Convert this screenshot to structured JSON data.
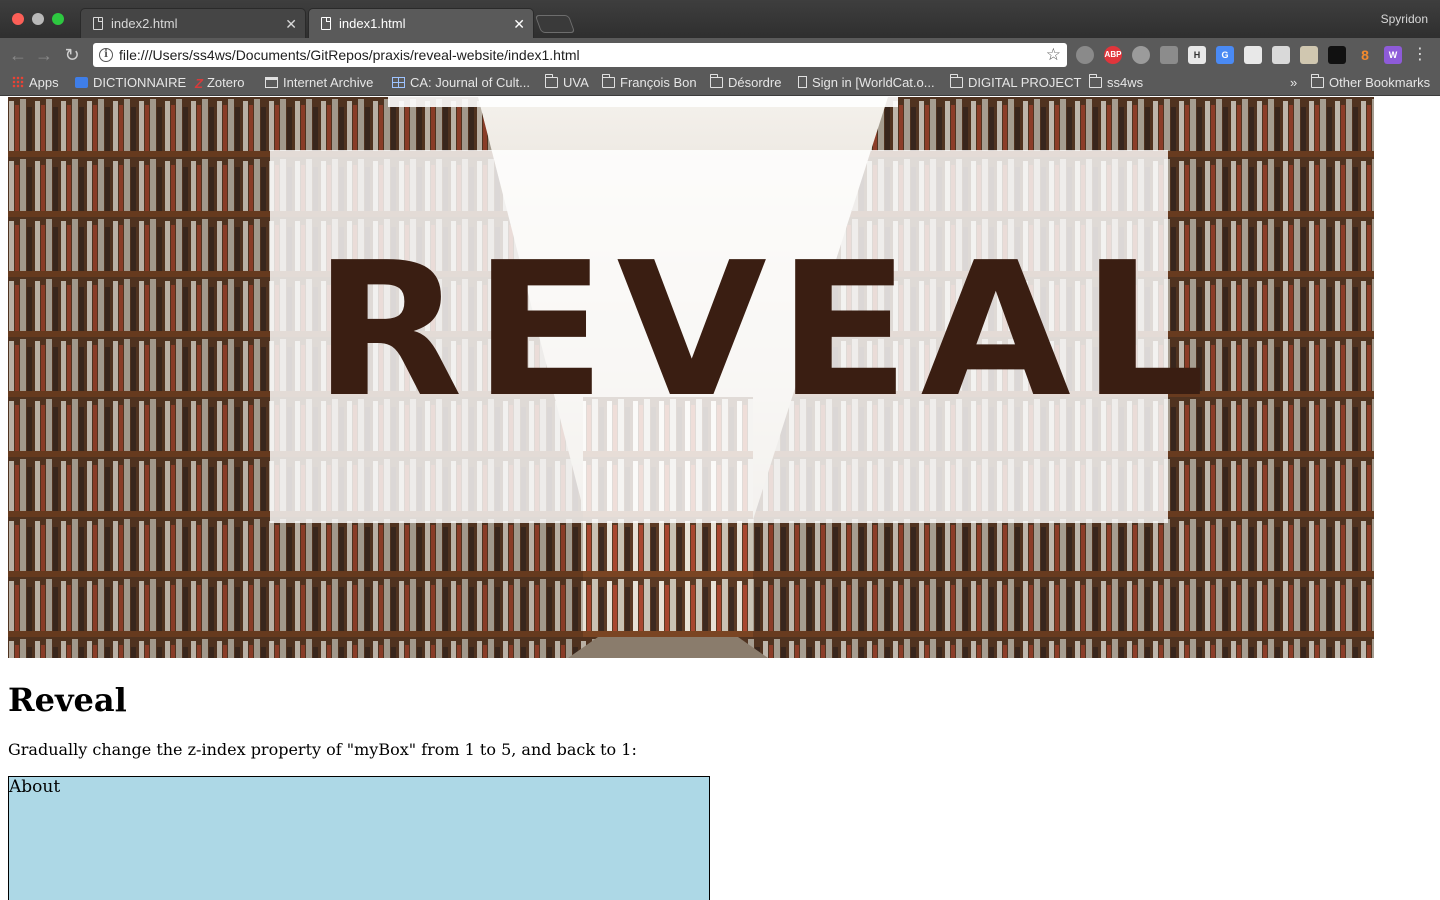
{
  "window": {
    "profile_name": "Spyridon"
  },
  "tabs": [
    {
      "title": "index2.html",
      "active": false
    },
    {
      "title": "index1.html",
      "active": true
    }
  ],
  "toolbar": {
    "url": "file:///Users/ss4ws/Documents/GitRepos/praxis/reveal-website/index1.html",
    "extensions": [
      "pocket-icon",
      "adblock-plus-icon",
      "extension-icon",
      "chat-icon",
      "hypothesis-icon",
      "translate-icon",
      "mail-icon",
      "document-icon",
      "cookie-icon",
      "lock-icon",
      "fire-icon",
      "wix-icon"
    ],
    "adblock_label": "ABP"
  },
  "bookmarks": {
    "items": [
      {
        "label": "Apps",
        "icon": "apps-icon"
      },
      {
        "label": "DICTIONNAIRE",
        "icon": "c-icon"
      },
      {
        "label": "Zotero",
        "icon": "zotero-icon"
      },
      {
        "label": "Internet Archive",
        "icon": "archive-icon"
      },
      {
        "label": "CA: Journal of Cult...",
        "icon": "grid-icon"
      },
      {
        "label": "UVA",
        "icon": "folder-icon"
      },
      {
        "label": "François Bon",
        "icon": "folder-icon"
      },
      {
        "label": "Désordre",
        "icon": "folder-icon"
      },
      {
        "label": "Sign in [WorldCat.o...",
        "icon": "page-icon"
      },
      {
        "label": "DIGITAL PROJECT",
        "icon": "folder-icon"
      },
      {
        "label": "ss4ws",
        "icon": "folder-icon"
      }
    ],
    "overflow": "»",
    "other": "Other Bookmarks"
  },
  "page": {
    "hero_word": "REVEAL",
    "heading": "Reveal",
    "description": "Gradually change the z-index property of \"myBox\" from 1 to 5, and back to 1:",
    "box_label": "About",
    "box_color": "#add8e6"
  }
}
